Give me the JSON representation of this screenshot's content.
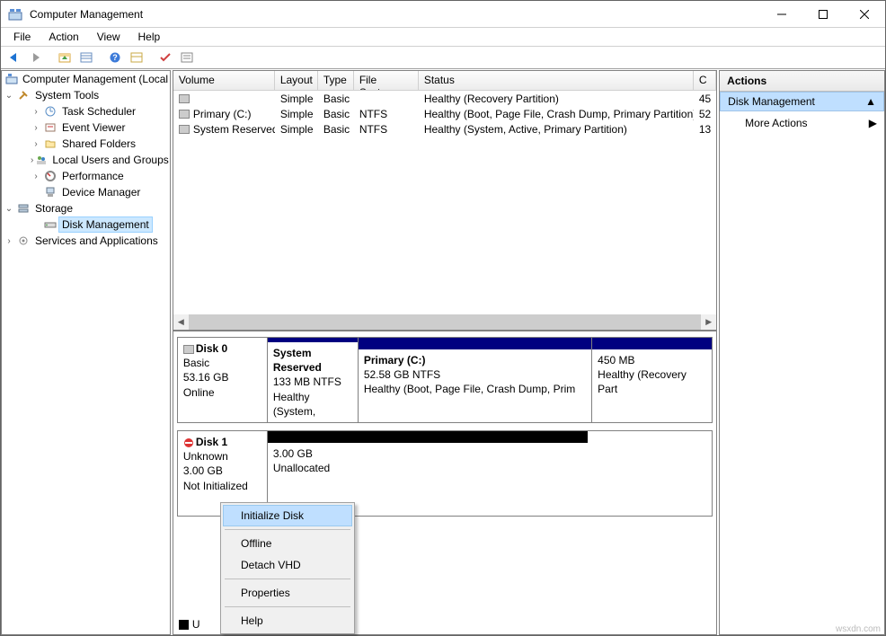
{
  "window": {
    "title": "Computer Management"
  },
  "menu": [
    "File",
    "Action",
    "View",
    "Help"
  ],
  "toolbar_icons": [
    "back-icon",
    "forward-icon",
    "sep",
    "up-icon",
    "properties-icon",
    "sep",
    "help-icon",
    "refresh-icon",
    "sep",
    "check-icon",
    "list-icon"
  ],
  "tree": {
    "root": "Computer Management (Local",
    "system_tools": {
      "label": "System Tools",
      "children": [
        "Task Scheduler",
        "Event Viewer",
        "Shared Folders",
        "Local Users and Groups",
        "Performance",
        "Device Manager"
      ]
    },
    "storage": {
      "label": "Storage",
      "disk_mgmt": "Disk Management"
    },
    "services": "Services and Applications"
  },
  "volumes": {
    "headers": [
      "Volume",
      "Layout",
      "Type",
      "File System",
      "Status",
      "C"
    ],
    "rows": [
      {
        "vol": "",
        "layout": "Simple",
        "type": "Basic",
        "fs": "",
        "status": "Healthy (Recovery Partition)",
        "c": "45"
      },
      {
        "vol": "Primary (C:)",
        "layout": "Simple",
        "type": "Basic",
        "fs": "NTFS",
        "status": "Healthy (Boot, Page File, Crash Dump, Primary Partition)",
        "c": "52"
      },
      {
        "vol": "System Reserved",
        "layout": "Simple",
        "type": "Basic",
        "fs": "NTFS",
        "status": "Healthy (System, Active, Primary Partition)",
        "c": "13"
      }
    ]
  },
  "disks": [
    {
      "name": "Disk 0",
      "kind": "Basic",
      "size": "53.16 GB",
      "state": "Online",
      "parts": [
        {
          "title": "System Reserved",
          "line2": "133 MB NTFS",
          "line3": "Healthy (System, ",
          "flex": "0 0 100px",
          "stripe": "navy"
        },
        {
          "title": "Primary  (C:)",
          "line2": "52.58 GB NTFS",
          "line3": "Healthy (Boot, Page File, Crash Dump, Prim",
          "flex": "1",
          "stripe": "navy"
        },
        {
          "title": "",
          "line2": "450 MB",
          "line3": "Healthy (Recovery Part",
          "flex": "0 0 134px",
          "stripe": "navy"
        }
      ]
    },
    {
      "name": "Disk 1",
      "kind": "Unknown",
      "size": "3.00 GB",
      "state": "Not Initialized",
      "warning": true,
      "parts": [
        {
          "title": "",
          "line2": "3.00 GB",
          "line3": "Unallocated",
          "flex": "0 0 356px",
          "stripe": "black"
        }
      ]
    }
  ],
  "legend": "U",
  "actions": {
    "title": "Actions",
    "section": "Disk Management",
    "more": "More Actions"
  },
  "context_menu": {
    "items": [
      "Initialize Disk",
      "Offline",
      "Detach VHD",
      "Properties",
      "Help"
    ],
    "highlighted": 0
  },
  "watermark": "wsxdn.com"
}
